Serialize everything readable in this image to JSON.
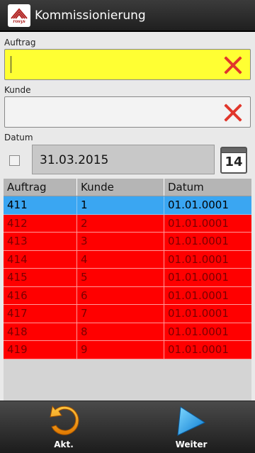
{
  "titlebar": {
    "title": "Kommissionierung",
    "logo_text": "rosys"
  },
  "form": {
    "auftrag_label": "Auftrag",
    "auftrag_value": "",
    "kunde_label": "Kunde",
    "kunde_value": "",
    "datum_label": "Datum",
    "datum_value": "31.03.2015",
    "datum_checked": false,
    "calendar_day": "14"
  },
  "table": {
    "headers": [
      "Auftrag",
      "Kunde",
      "Datum"
    ],
    "rows": [
      {
        "auftrag": "411",
        "kunde": "1",
        "datum": "01.01.0001",
        "selected": true
      },
      {
        "auftrag": "412",
        "kunde": "2",
        "datum": "01.01.0001"
      },
      {
        "auftrag": "413",
        "kunde": "3",
        "datum": "01.01.0001"
      },
      {
        "auftrag": "414",
        "kunde": "4",
        "datum": "01.01.0001"
      },
      {
        "auftrag": "415",
        "kunde": "5",
        "datum": "01.01.0001"
      },
      {
        "auftrag": "416",
        "kunde": "6",
        "datum": "01.01.0001"
      },
      {
        "auftrag": "417",
        "kunde": "7",
        "datum": "01.01.0001"
      },
      {
        "auftrag": "418",
        "kunde": "8",
        "datum": "01.01.0001"
      },
      {
        "auftrag": "419",
        "kunde": "9",
        "datum": "01.01.0001"
      }
    ]
  },
  "bottombar": {
    "refresh_label": "Akt.",
    "refresh_icon": "refresh-arrow-icon",
    "next_label": "Weiter",
    "next_icon": "play-triangle-icon"
  },
  "colors": {
    "required_field": "#ffff33",
    "row_red": "#ff0000",
    "row_selected": "#3aa6f2",
    "clear_x": "#e1362b"
  }
}
